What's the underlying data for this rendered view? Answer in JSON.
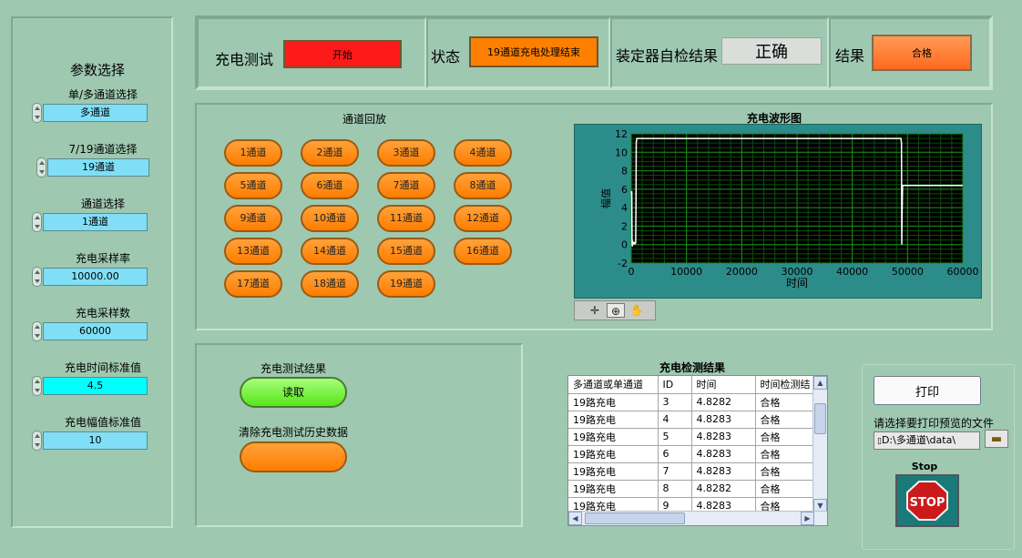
{
  "params": {
    "title": "参数选择",
    "items": [
      {
        "label": "单/多通道选择",
        "value": "多通道"
      },
      {
        "label": "7/19通道选择",
        "value": "19通道"
      },
      {
        "label": "通道选择",
        "value": "1通道"
      },
      {
        "label": "充电采样率",
        "value": "10000.00"
      },
      {
        "label": "充电采样数",
        "value": "60000"
      },
      {
        "label": "充电时间标准值",
        "value": "4.5"
      },
      {
        "label": "充电幅值标准值",
        "value": "10"
      }
    ]
  },
  "top": {
    "charge_test_label": "充电测试",
    "start_label": "开始",
    "status_label": "状态",
    "status_value": "19通道充电处理结束",
    "selfcheck_label": "装定器自检结果",
    "selfcheck_value": "正确",
    "result_label": "结果",
    "result_value": "合格"
  },
  "colors": {
    "background": "#9fc8b1",
    "start_button": "#ff1a1a",
    "orange": "#ff8000",
    "field": "#80dff6",
    "green_button": "#66ff33",
    "chart_bg": "#000000",
    "chart_grid": "#1a8a1a",
    "chart_trace": "#ffffff"
  },
  "channels": {
    "title": "通道回放",
    "buttons": [
      "1通道",
      "2通道",
      "3通道",
      "4通道",
      "5通道",
      "6通道",
      "7通道",
      "8通道",
      "9通道",
      "10通道",
      "11通道",
      "12通道",
      "13通道",
      "14通道",
      "15通道",
      "16通道",
      "17通道",
      "18通道",
      "19通道"
    ]
  },
  "chart_data": {
    "type": "line",
    "title": "充电波形图",
    "xlabel": "时间",
    "ylabel": "幅值",
    "xlim": [
      0,
      60000
    ],
    "ylim": [
      -2,
      12
    ],
    "xticks": [
      0,
      10000,
      20000,
      30000,
      40000,
      50000,
      60000
    ],
    "yticks": [
      -2,
      0,
      2,
      4,
      6,
      8,
      10,
      12
    ],
    "grid": true,
    "series": [
      {
        "x": [
          0,
          100,
          150,
          200,
          300,
          400,
          500,
          600,
          700,
          800,
          850,
          900,
          1000,
          1500,
          48800,
          48900,
          48950,
          49000,
          49100,
          60000
        ],
        "y": [
          5.5,
          5.8,
          0.2,
          -0.2,
          0.3,
          0.2,
          0.1,
          0.2,
          0.1,
          0.2,
          4.0,
          11.0,
          11.5,
          11.5,
          11.5,
          11.0,
          0.0,
          3.0,
          6.4,
          6.4
        ]
      }
    ]
  },
  "toolbar": {
    "icons": [
      "crosshair-icon",
      "zoom-icon",
      "pan-hand-icon"
    ]
  },
  "test_result": {
    "title": "充电测试结果",
    "read_label": "读取",
    "clear_label": "清除充电测试历史数据"
  },
  "table": {
    "title": "充电检测结果",
    "headers": [
      "多通道或单通道",
      "ID",
      "时间",
      "时间检测结"
    ],
    "rows": [
      [
        "19路充电",
        "3",
        "4.8282",
        "合格"
      ],
      [
        "19路充电",
        "4",
        "4.8283",
        "合格"
      ],
      [
        "19路充电",
        "5",
        "4.8283",
        "合格"
      ],
      [
        "19路充电",
        "6",
        "4.8283",
        "合格"
      ],
      [
        "19路充电",
        "7",
        "4.8283",
        "合格"
      ],
      [
        "19路充电",
        "8",
        "4.8282",
        "合格"
      ],
      [
        "19路充电",
        "9",
        "4.8283",
        "合格"
      ]
    ]
  },
  "print": {
    "print_label": "打印",
    "file_prompt": "请选择要打印预览的文件",
    "file_path": "D:\\多通道\\data\\",
    "stop_title": "Stop",
    "stop_label": "STOP"
  }
}
